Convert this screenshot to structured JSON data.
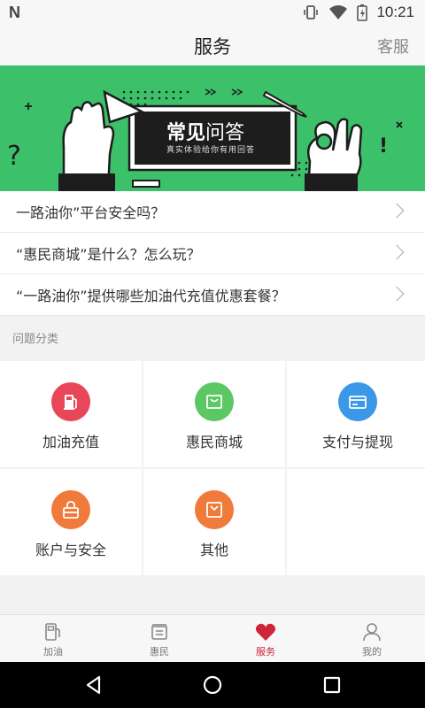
{
  "status_bar": {
    "logo": "N",
    "time": "10:21"
  },
  "header": {
    "title": "服务",
    "right_action": "客服"
  },
  "banner": {
    "title_bold": "常见",
    "title_light": "问答",
    "subtitle": "真实体验给你有用回答",
    "bg_color": "#3cc06a"
  },
  "faq": {
    "items": [
      {
        "text": "一路油你”平台安全吗？"
      },
      {
        "text": "“惠民商城”是什么？怎么玩？"
      },
      {
        "text": "“一路油你”提供哪些加油代充值优惠套餐？"
      }
    ]
  },
  "categories": {
    "section_label": "问题分类",
    "items": [
      {
        "label": "加油充值",
        "icon": "fuel-pump-icon",
        "color": "#e8475a"
      },
      {
        "label": "惠民商城",
        "icon": "shopping-bag-icon",
        "color": "#5cc864"
      },
      {
        "label": "支付与提现",
        "icon": "card-icon",
        "color": "#3b97e8"
      },
      {
        "label": "账户与安全",
        "icon": "lock-icon",
        "color": "#f07a3a"
      },
      {
        "label": "其他",
        "icon": "document-icon",
        "color": "#f07a3a"
      }
    ]
  },
  "tabbar": {
    "items": [
      {
        "label": "加油",
        "icon": "fuel-icon"
      },
      {
        "label": "惠民",
        "icon": "store-icon"
      },
      {
        "label": "服务",
        "icon": "heart-icon",
        "active": true
      },
      {
        "label": "我的",
        "icon": "person-icon"
      }
    ],
    "active_color": "#d0243a"
  }
}
